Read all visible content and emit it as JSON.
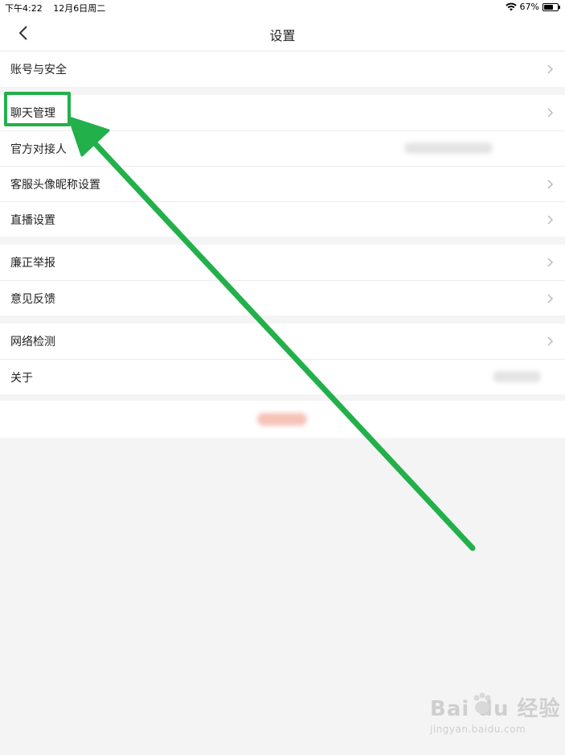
{
  "status_bar": {
    "time": "下午4:22",
    "date": "12月6日周二",
    "battery_percent": "67%",
    "battery_level": 0.67
  },
  "nav": {
    "title": "设置"
  },
  "groups": [
    {
      "items": [
        {
          "label": "账号与安全"
        }
      ]
    },
    {
      "items": [
        {
          "label": "聊天管理"
        },
        {
          "label": "官方对接人"
        },
        {
          "label": "客服头像昵称设置"
        },
        {
          "label": "直播设置"
        }
      ]
    },
    {
      "items": [
        {
          "label": "廉正举报"
        },
        {
          "label": "意见反馈"
        }
      ]
    },
    {
      "items": [
        {
          "label": "网络检测"
        },
        {
          "label": "关于"
        }
      ]
    }
  ],
  "annotation": {
    "color": "#22b04a"
  },
  "watermark": {
    "main": "Bai du 经验",
    "sub": "jingyan.baidu.com"
  },
  "icons": [
    "wifi-icon",
    "battery-icon",
    "back-chevron-icon",
    "chevron-right-icon",
    "paw-icon"
  ]
}
